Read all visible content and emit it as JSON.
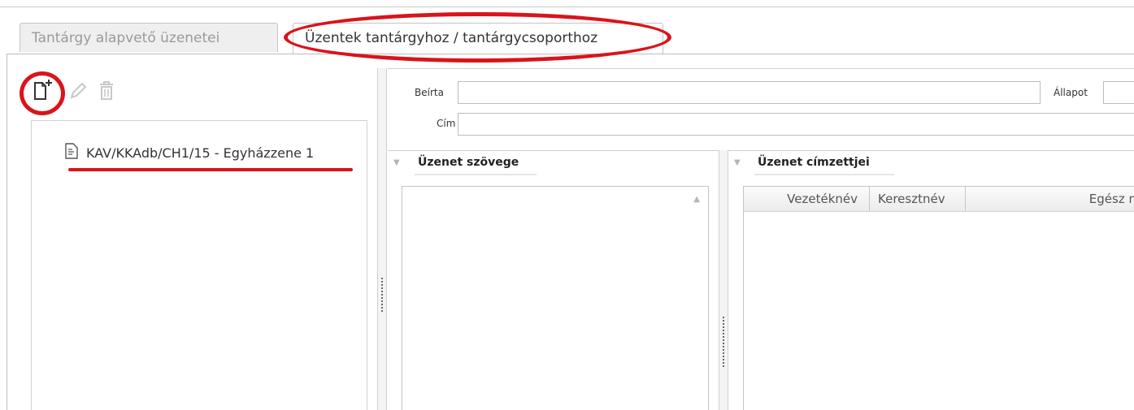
{
  "tabs": [
    {
      "label": "Tantárgy alapvető üzenetei",
      "active": false
    },
    {
      "label": "Üzentek tantárgyhoz / tantárgycsoporthoz",
      "active": true
    }
  ],
  "toolbar": {
    "new_icon": "new-document-icon",
    "edit_icon": "pencil-icon",
    "delete_icon": "trash-icon"
  },
  "tree": {
    "items": [
      {
        "label": "KAV/KKAdb/CH1/15 - Egyházzene 1",
        "icon": "document-icon"
      }
    ]
  },
  "form": {
    "beirta_label": "Beírta",
    "allapot_label": "Állapot",
    "cim_label": "Cím"
  },
  "sections": {
    "message_text": "Üzenet szövege",
    "recipients": "Üzenet címzettjei"
  },
  "recipients_table": {
    "columns": [
      "Vezetéknév",
      "Keresztnév",
      "Egész n"
    ]
  },
  "colors": {
    "annotation": "#d9141a",
    "border": "#bdbdbd"
  }
}
